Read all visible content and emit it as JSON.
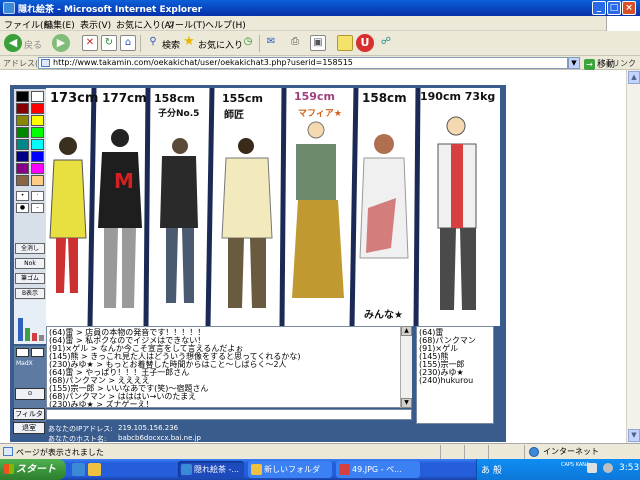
{
  "window": {
    "title": "隠れ絵茶 - Microsoft Internet Explorer",
    "controls": [
      "_",
      "□",
      "×"
    ]
  },
  "menu": [
    "ファイル(F)",
    "編集(E)",
    "表示(V)",
    "お気に入り(A)",
    "ツール(T)",
    "ヘルプ(H)"
  ],
  "toolbar": {
    "back": "戻る",
    "search": "検索",
    "favorites": "お気に入り"
  },
  "address": {
    "label": "アドレス(D)",
    "url": "http://www.takamin.com/oekakichat/user/oekakichat3.php?userid=158515",
    "go": "移動",
    "links": "リンク"
  },
  "oekaki": {
    "palette_colors": [
      "#000000",
      "#ffffff",
      "#880000",
      "#ff0000",
      "#888800",
      "#ffff00",
      "#008800",
      "#00ff00",
      "#008888",
      "#00ffff",
      "#000088",
      "#0000ff",
      "#880088",
      "#ff00ff",
      "#886644",
      "#ffcc88"
    ],
    "tools": [
      "全消し",
      "Nok",
      "筆ゴム",
      "B表示"
    ],
    "color_levels": [
      0.6,
      0.35,
      0.2,
      0.15
    ],
    "side_labels": [
      "MadX"
    ],
    "filter_button": "フィルタ",
    "exit_button": "退室",
    "ip_label": "あなたのIPアドレス:",
    "ip_value": "219.105.156.236",
    "host_label": "あなたのホスト名:",
    "host_value": "babcb6docxcx.bai.ne.jp"
  },
  "canvas_texts": [
    "173cm",
    "177cm",
    "158cm",
    "155cm",
    "159cm",
    "158cm",
    "190cm 73kg",
    "子分No.5",
    "師匠",
    "マフィア★",
    "M",
    "みんな★"
  ],
  "chat": [
    "(64)雷 > 店員の本物の発音です！！！！！",
    "(64)雷 > 私ボクなのでイジメはできない！",
    "(91)×ゲル > なんか今こそ宣言をして言えるんだよぉ",
    "(145)熊 > きっこれ見た人はどういう想像をすると思ってくれるかな)",
    "(230)みゆ★ > もっとお着替した時間からはこと〜しばらく〜2人",
    "(64)雷 > やっぱり！！！王子一郎さん",
    "(68)パンクマン > ええええ",
    "(155)宗一郎 > いいなあです(笑)〜宿題さん",
    "(68)パンクマン > はははい→いのたまえ",
    "(230)みゆ★ > ズナゲーえ！"
  ],
  "users": [
    "(64)雷",
    "(68)パンクマン",
    "(91)×ゲル",
    "(145)熊",
    "(155)宗一郎",
    "(230)みゆ★",
    "(240)hukurou"
  ],
  "status": {
    "text": "ページが表示されました",
    "zone": "インターネット"
  },
  "taskbar": {
    "start": "スタート",
    "tasks": [
      "隠れ絵茶 -...",
      "新しいフォルダ",
      "49.JPG - ペ..."
    ],
    "ime": "あ 般",
    "caps": "CAPS KANA",
    "clock": "3:53"
  }
}
